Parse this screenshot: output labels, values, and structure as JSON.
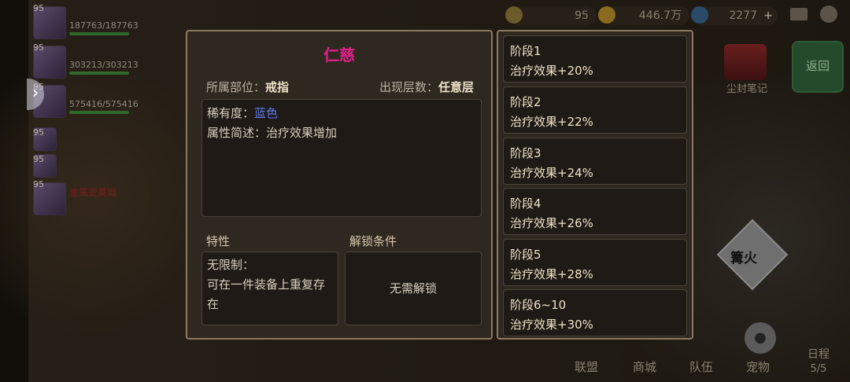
{
  "top_resources": {
    "stamina": "95",
    "gold": "446.7万",
    "gems": "2277"
  },
  "party": [
    {
      "level": "95",
      "hp": "187763/187763"
    },
    {
      "level": "95",
      "hp": "303213/303213"
    },
    {
      "level": "95",
      "hp": "575416/575416"
    },
    {
      "level": "95"
    },
    {
      "level": "95"
    },
    {
      "level": "95",
      "name": "金属史莱姆"
    }
  ],
  "item": {
    "name": "仁慈",
    "slot_label": "所属部位：",
    "slot_value": "戒指",
    "floor_label": "出现层数：",
    "floor_value": "任意层",
    "rarity_label": "稀有度：",
    "rarity_value": "蓝色",
    "rarity_color": "#5f7cf0",
    "summary_label": "属性简述：",
    "summary_value": "治疗效果增加",
    "trait_title": "特性",
    "trait_line1": "无限制：",
    "trait_line2": "可在一件装备上重复存",
    "trait_line3": "在",
    "unlock_title": "解锁条件",
    "unlock_value": "无需解锁"
  },
  "stages": [
    {
      "name": "阶段1",
      "effect": "治疗效果+20%"
    },
    {
      "name": "阶段2",
      "effect": "治疗效果+22%"
    },
    {
      "name": "阶段3",
      "effect": "治疗效果+24%"
    },
    {
      "name": "阶段4",
      "effect": "治疗效果+26%"
    },
    {
      "name": "阶段5",
      "effect": "治疗效果+28%"
    },
    {
      "name": "阶段6~10",
      "effect": "治疗效果+30%"
    }
  ],
  "side": {
    "return_label": "返回",
    "book_label": "尘封笔记",
    "bonfire_label": "篝火"
  },
  "bottom_nav": {
    "alliance": "联盟",
    "shop": "商城",
    "team": "队伍",
    "pet": "宠物",
    "schedule": "日程",
    "schedule_count": "5/5"
  }
}
